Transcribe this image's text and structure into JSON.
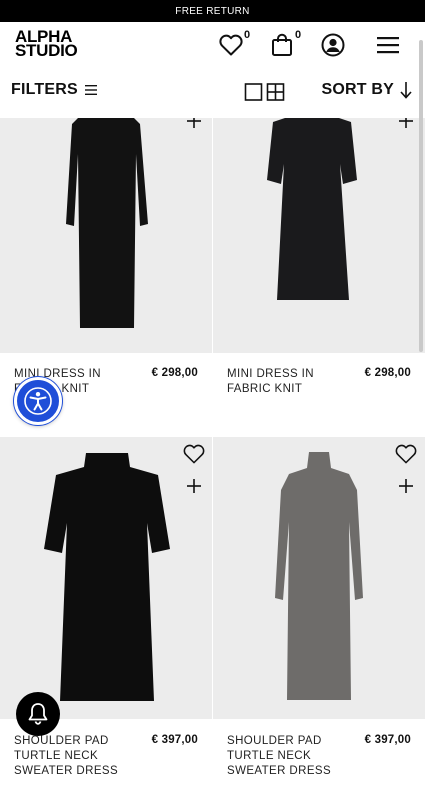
{
  "promo": {
    "text": "FREE RETURN"
  },
  "header": {
    "logo_line1": "ALPHA",
    "logo_line2": "STUDIO",
    "icons": [
      "heart-icon",
      "bag-icon",
      "account-icon",
      "menu-icon"
    ],
    "wishlist_count": "0",
    "cart_count": "0"
  },
  "toolbar": {
    "filters_label": "FILTERS",
    "sort_label": "SORT BY"
  },
  "products": [
    {
      "name": "MINI DRESS IN FABRIC KNIT",
      "price": "€ 298,00",
      "color": "#121212"
    },
    {
      "name": "MINI DRESS IN FABRIC KNIT",
      "price": "€ 298,00",
      "color": "#1a1a1c"
    },
    {
      "name": "SHOULDER PAD TURTLE NECK SWEATER DRESS",
      "price": "€ 397,00",
      "color": "#0d0d0d"
    },
    {
      "name": "SHOULDER PAD TURTLE NECK SWEATER DRESS",
      "price": "€ 397,00",
      "color": "#6e6c6a"
    }
  ],
  "colors": {
    "accessibility_button": "#1f4ed8",
    "image_background": "#ececec"
  }
}
